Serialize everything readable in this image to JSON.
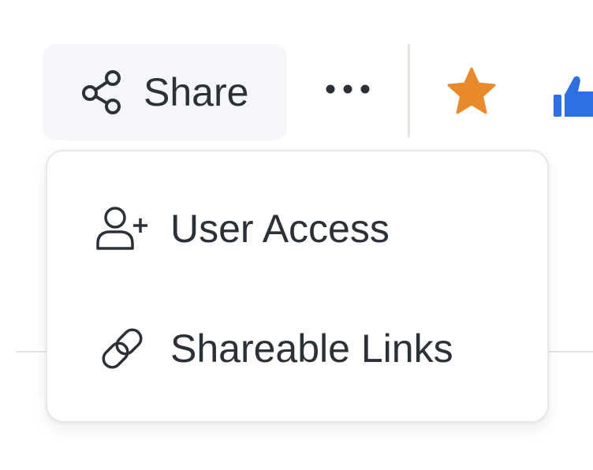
{
  "toolbar": {
    "share": {
      "label": "Share",
      "icon": "share-icon"
    },
    "more": {
      "icon": "more-horizontal-icon"
    },
    "favorite": {
      "icon": "star-icon",
      "color": "#e8892b"
    },
    "like": {
      "icon": "thumbs-up-icon",
      "color": "#2f6fe4"
    }
  },
  "share_menu": {
    "items": [
      {
        "label": "User Access",
        "icon": "user-add-icon"
      },
      {
        "label": "Shareable Links",
        "icon": "link-icon"
      }
    ]
  },
  "colors": {
    "text": "#2c3138",
    "button_bg": "#f4f6f9",
    "border": "#e4e7ec"
  }
}
